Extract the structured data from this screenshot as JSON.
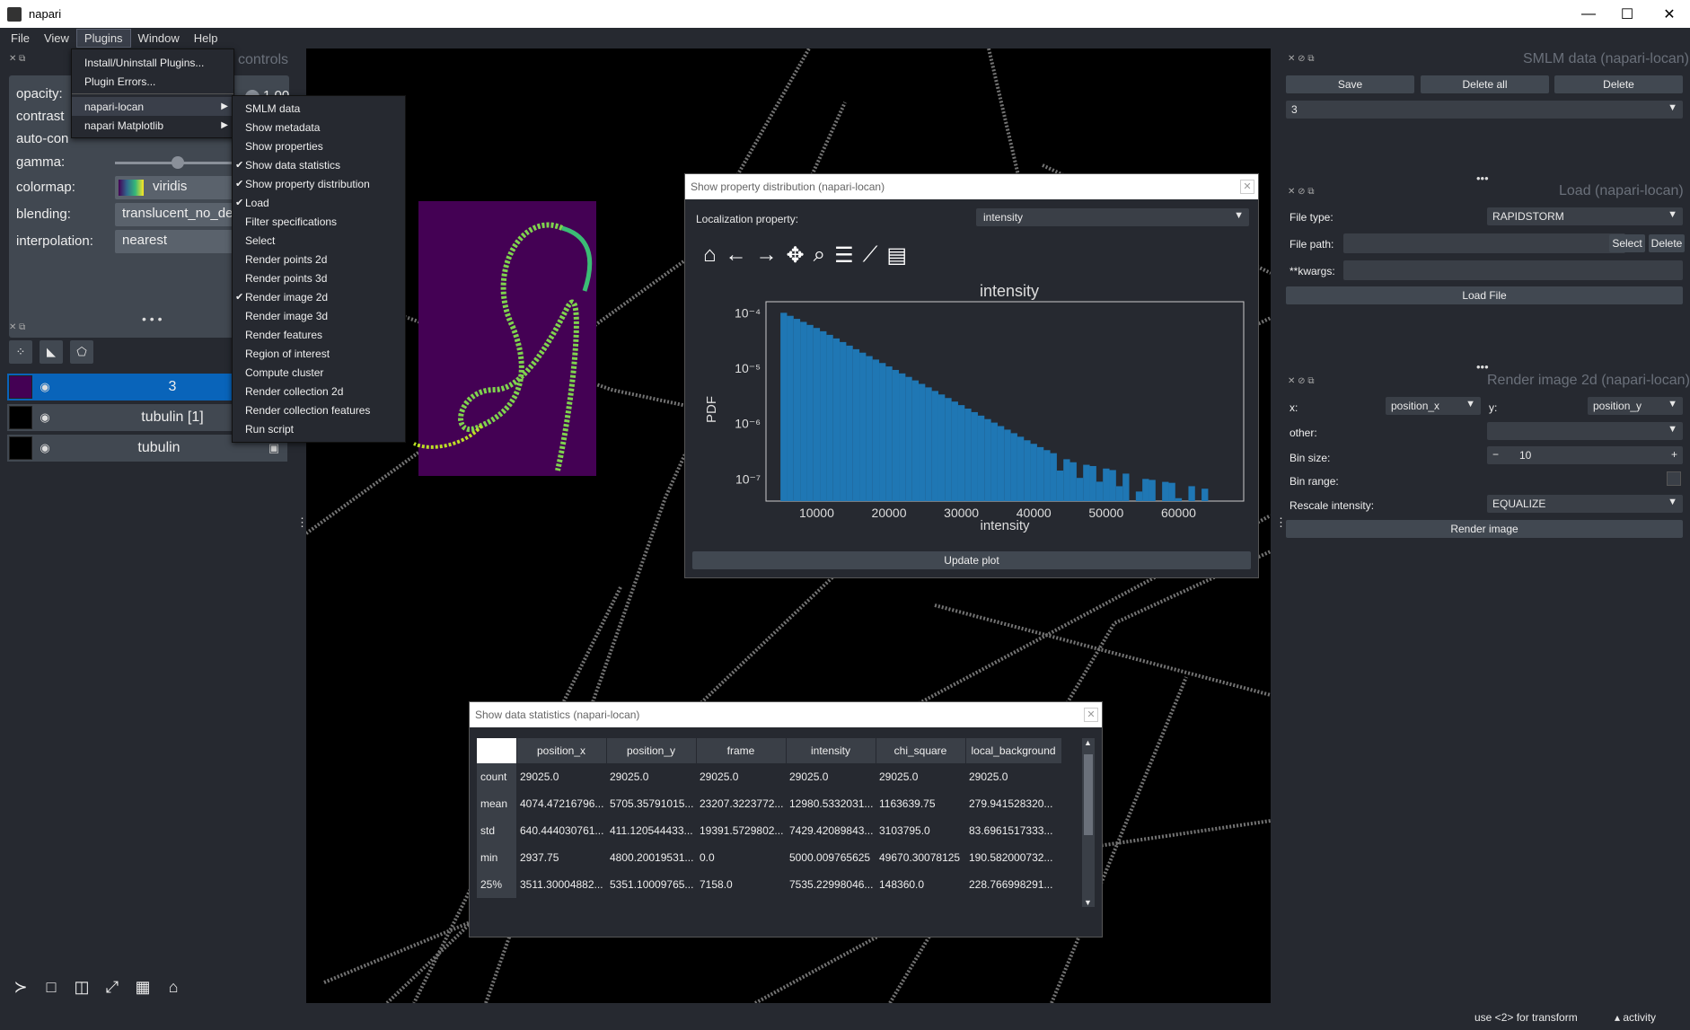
{
  "window": {
    "title": "napari",
    "minimize": "—",
    "maximize": "☐",
    "close": "✕"
  },
  "menubar": [
    "File",
    "View",
    "Plugins",
    "Window",
    "Help"
  ],
  "plugins_menu": {
    "items": [
      "Install/Uninstall Plugins...",
      "Plugin Errors...",
      "napari-locan",
      "napari Matplotlib"
    ]
  },
  "locan_submenu": [
    {
      "label": "SMLM data",
      "checked": false
    },
    {
      "label": "Show metadata",
      "checked": false
    },
    {
      "label": "Show properties",
      "checked": false
    },
    {
      "label": "Show data statistics",
      "checked": true
    },
    {
      "label": "Show property distribution",
      "checked": true
    },
    {
      "label": "Load",
      "checked": true
    },
    {
      "label": "Filter specifications",
      "checked": false
    },
    {
      "label": "Select",
      "checked": false
    },
    {
      "label": "Render points 2d",
      "checked": false
    },
    {
      "label": "Render points 3d",
      "checked": false
    },
    {
      "label": "Render image 2d",
      "checked": true
    },
    {
      "label": "Render image 3d",
      "checked": false
    },
    {
      "label": "Render features",
      "checked": false
    },
    {
      "label": "Region of interest",
      "checked": false
    },
    {
      "label": "Compute cluster",
      "checked": false
    },
    {
      "label": "Render collection 2d",
      "checked": false
    },
    {
      "label": "Render collection features",
      "checked": false
    },
    {
      "label": "Run script",
      "checked": false
    }
  ],
  "layer_controls": {
    "title": "controls",
    "opacity_label": "opacity:",
    "opacity_value": "1.00",
    "contrast_label": "contrast",
    "autocontrast_label": "auto-con",
    "gamma_label": "gamma:",
    "gamma_value": 0.5,
    "colormap_label": "colormap:",
    "colormap_value": "viridis",
    "blending_label": "blending:",
    "blending_value": "translucent_no_de",
    "interpolation_label": "interpolation:",
    "interpolation_value": "nearest"
  },
  "layers": [
    {
      "name": "3",
      "selected": true
    },
    {
      "name": "tubulin [1]",
      "selected": false
    },
    {
      "name": "tubulin",
      "selected": false
    }
  ],
  "smlm_panel": {
    "title": "SMLM data (napari-locan)",
    "save": "Save",
    "delete_all": "Delete all",
    "delete": "Delete",
    "selected": "3"
  },
  "load_panel": {
    "title": "Load (napari-locan)",
    "file_type_label": "File type:",
    "file_type_value": "RAPIDSTORM",
    "file_path_label": "File path:",
    "select": "Select",
    "delete": "Delete",
    "kwargs_label": "**kwargs:",
    "load_file": "Load File"
  },
  "render_panel": {
    "title": "Render image 2d (napari-locan)",
    "x_label": "x:",
    "x_value": "position_x",
    "y_label": "y:",
    "y_value": "position_y",
    "other_label": "other:",
    "bin_size_label": "Bin size:",
    "bin_size_value": "10",
    "bin_range_label": "Bin range:",
    "rescale_label": "Rescale intensity:",
    "rescale_value": "EQUALIZE",
    "render": "Render image"
  },
  "prop_dist": {
    "title": "Show property distribution (napari-locan)",
    "prop_label": "Localization property:",
    "prop_value": "intensity",
    "update": "Update plot"
  },
  "chart_data": {
    "type": "bar",
    "title": "intensity",
    "xlabel": "intensity",
    "ylabel": "PDF",
    "yscale": "log",
    "xticks": [
      "10000",
      "20000",
      "30000",
      "40000",
      "50000",
      "60000"
    ],
    "yticks": [
      "10⁻⁴",
      "10⁻⁵",
      "10⁻⁶",
      "10⁻⁷"
    ],
    "xlim": [
      3000,
      69000
    ],
    "ylim_exp": [
      -7.4,
      -3.8
    ],
    "color": "#1f77b4",
    "x": [
      5000,
      10000,
      15000,
      20000,
      25000,
      30000,
      35000,
      40000,
      45000,
      50000,
      55000,
      60000,
      65000
    ],
    "values": [
      0.0001,
      5e-05,
      2.2e-05,
      1e-05,
      4.5e-06,
      2e-06,
      9e-07,
      4e-07,
      2e-07,
      1.5e-07,
      1e-07,
      8e-08,
      6e-08
    ]
  },
  "stats": {
    "title": "Show data statistics (napari-locan)",
    "columns": [
      "position_x",
      "position_y",
      "frame",
      "intensity",
      "chi_square",
      "local_background"
    ],
    "rows": [
      {
        "label": "count",
        "cells": [
          "29025.0",
          "29025.0",
          "29025.0",
          "29025.0",
          "29025.0",
          "29025.0"
        ]
      },
      {
        "label": "mean",
        "cells": [
          "4074.47216796...",
          "5705.35791015...",
          "23207.3223772...",
          "12980.5332031...",
          "1163639.75",
          "279.941528320..."
        ]
      },
      {
        "label": "std",
        "cells": [
          "640.444030761...",
          "411.120544433...",
          "19391.5729802...",
          "7429.42089843...",
          "3103795.0",
          "83.6961517333..."
        ]
      },
      {
        "label": "min",
        "cells": [
          "2937.75",
          "4800.20019531...",
          "0.0",
          "5000.009765625",
          "49670.30078125",
          "190.582000732..."
        ]
      },
      {
        "label": "25%",
        "cells": [
          "3511.30004882...",
          "5351.10009765...",
          "7158.0",
          "7535.22998046...",
          "148360.0",
          "228.766998291..."
        ]
      }
    ]
  },
  "statusbar": {
    "hint": "use <2> for transform",
    "activity": "activity"
  },
  "colors": {
    "selected_layer": "#0964ba",
    "bg": "#262930",
    "panel": "#414851"
  }
}
